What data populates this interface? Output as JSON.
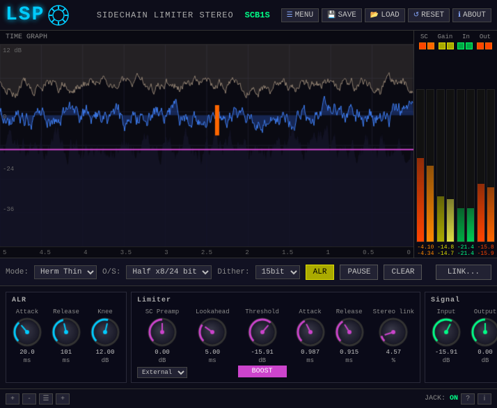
{
  "header": {
    "logo": "LSP",
    "title": "SIDECHAIN LIMITER STEREO",
    "id": "SCB1S",
    "menu_label": "MENU",
    "save_label": "SAVE",
    "load_label": "LOAD",
    "reset_label": "RESET",
    "about_label": "ABOUT"
  },
  "graph": {
    "label": "TIME GRAPH",
    "db_labels": [
      "12 dB",
      "0",
      "-24",
      "-36"
    ],
    "time_labels": [
      "5",
      "4.5",
      "4",
      "3.5",
      "3",
      "2.5",
      "2",
      "1.5",
      "1",
      "0.5",
      "0"
    ],
    "time_labels2": [
      "3.5",
      "3",
      "2.5",
      "2",
      "1.5",
      "1",
      "0.5",
      "0"
    ]
  },
  "meters": {
    "headers": [
      "SC",
      "Gain",
      "In",
      "Out"
    ],
    "sc_val1": "-4.10",
    "sc_val2": "-4.34",
    "gain_val1": "-14.8",
    "gain_val2": "-14.7",
    "in_val1": "-21.4",
    "in_val2": "-21.4",
    "out_val1": "-15.8",
    "out_val2": "-15.9"
  },
  "controls": {
    "mode_label": "Mode:",
    "mode_value": "Herm Thin",
    "os_label": "O/S:",
    "os_value": "Half x8/24 bit",
    "dither_label": "Dither:",
    "dither_value": "15bit",
    "alr_btn": "ALR",
    "pause_btn": "PAUSE",
    "clear_btn": "CLEAR",
    "link_btn": "LINK..."
  },
  "alr_group": {
    "title": "ALR",
    "attack_label": "Attack",
    "attack_value": "20.0",
    "attack_unit": "ms",
    "release_label": "Release",
    "release_value": "101",
    "release_unit": "ms",
    "knee_label": "Knee",
    "knee_value": "12.00",
    "knee_unit": "dB"
  },
  "limiter_group": {
    "title": "Limiter",
    "sc_preamp_label": "SC Preamp",
    "sc_preamp_value": "0.00",
    "sc_preamp_unit": "dB",
    "sc_preamp_select": "External",
    "lookahead_label": "Lookahead",
    "lookahead_value": "5.00",
    "lookahead_unit": "ms",
    "threshold_label": "Threshold",
    "threshold_value": "-15.91",
    "threshold_unit": "dB",
    "boost_label": "BOOST",
    "attack_label": "Attack",
    "attack_value": "0.987",
    "attack_unit": "ms",
    "release_label": "Release",
    "release_value": "0.915",
    "release_unit": "ms",
    "stereo_link_label": "Stereo link",
    "stereo_link_value": "4.57",
    "stereo_link_unit": "%"
  },
  "signal_group": {
    "title": "Signal",
    "input_label": "Input",
    "input_value": "-15.91",
    "input_unit": "dB",
    "output_label": "Output",
    "output_value": "0.00",
    "output_unit": "dB"
  },
  "footer": {
    "add_label": "+",
    "remove_label": "-",
    "jack_label": "JACK:",
    "jack_status": "ON"
  }
}
